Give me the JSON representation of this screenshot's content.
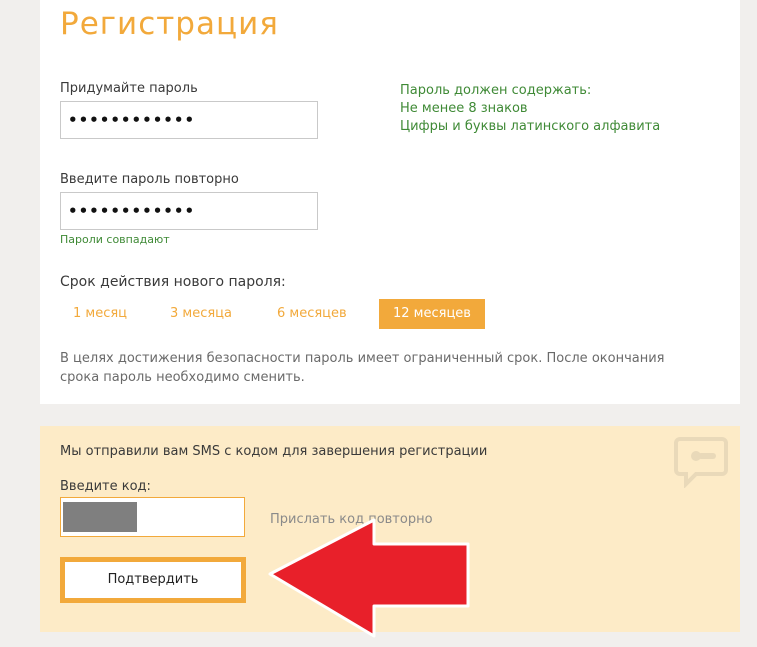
{
  "page_title": "Регистрация",
  "password": {
    "label": "Придумайте пароль",
    "value": "••••••••••••",
    "confirm_label": "Введите пароль повторно",
    "confirm_value": "••••••••••••",
    "match_status": "Пароли совпадают"
  },
  "requirements": {
    "heading": "Пароль должен содержать:",
    "items": [
      "Не менее 8 знаков",
      "Цифры и буквы латинского алфавита"
    ]
  },
  "validity": {
    "label": "Срок действия нового пароля:",
    "options": [
      "1 месяц",
      "3 месяца",
      "6 месяцев",
      "12 месяцев"
    ],
    "selected": "12 месяцев",
    "note": "В целях достижения безопасности пароль имеет ограниченный срок. После окончания срока пароль необходимо сменить."
  },
  "sms": {
    "message": "Мы отправили вам SMS с кодом для завершения регистрации",
    "code_label": "Введите код:",
    "resend_link": "Прислать код повторно",
    "submit_label": "Подтвердить",
    "icon": "sms-message-icon"
  },
  "colors": {
    "accent": "#f2a93b",
    "success": "#3f8a36",
    "sms_background": "#fdebc7",
    "arrow": "#e8202a"
  }
}
